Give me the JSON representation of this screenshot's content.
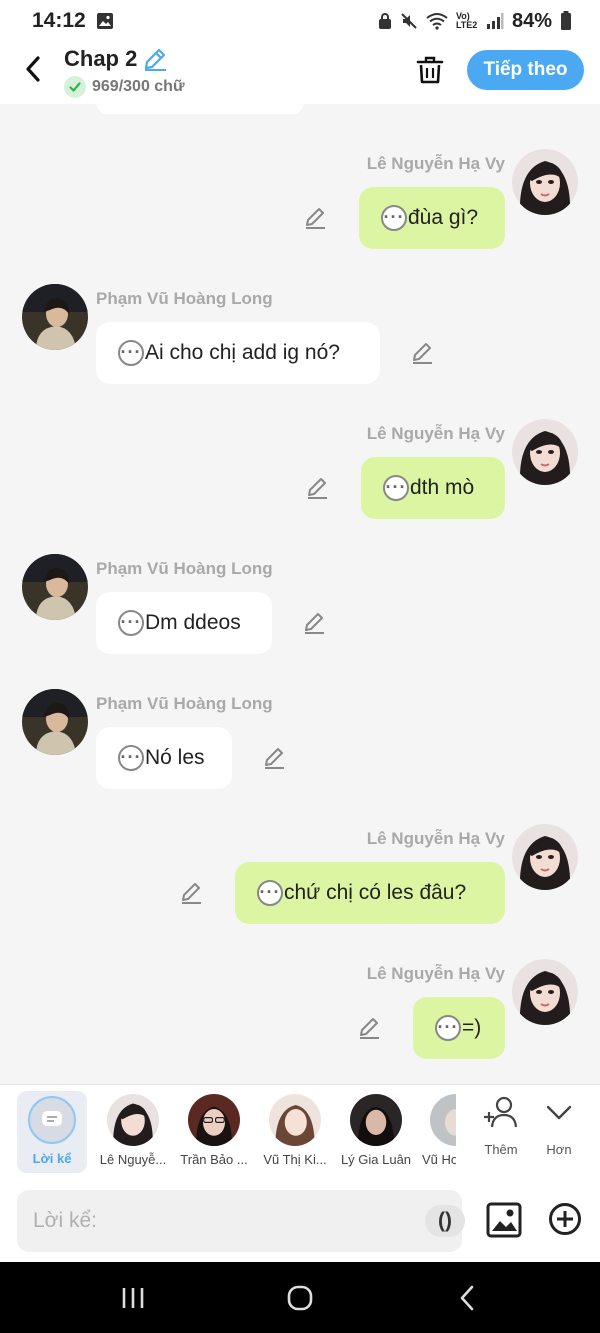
{
  "status_bar": {
    "time": "14:12",
    "battery": "84%",
    "network_label": "Vo) LTE2"
  },
  "header": {
    "title": "Chap 2",
    "word_count": "969/300 chữ",
    "next_button": "Tiếp theo"
  },
  "messages": [
    {
      "sender": "Lê Nguyễn Hạ Vy",
      "text": "đùa gì?",
      "side": "right"
    },
    {
      "sender": "Phạm Vũ Hoàng Long",
      "text": "Ai cho chị add ig nó?",
      "side": "left"
    },
    {
      "sender": "Lê Nguyễn Hạ Vy",
      "text": "dth mò",
      "side": "right"
    },
    {
      "sender": "Phạm Vũ Hoàng Long",
      "text": "Dm ddeos",
      "side": "left"
    },
    {
      "sender": "Phạm Vũ Hoàng Long",
      "text": "Nó les",
      "side": "left"
    },
    {
      "sender": "Lê Nguyễn Hạ Vy",
      "text": "chứ chị có les đâu?",
      "side": "right"
    },
    {
      "sender": "Lê Nguyễn Hạ Vy",
      "text": "=)",
      "side": "right"
    }
  ],
  "characters": {
    "narrator": "Lời kể",
    "items": [
      "Lê Nguyễ...",
      "Trần Bảo ...",
      "Vũ Thị Ki...",
      "Lý Gia Luân",
      "Vũ Ho"
    ],
    "add_label": "Thêm",
    "more_label": "Hơn"
  },
  "input": {
    "placeholder": "Lời kể:",
    "paren_button": "()"
  },
  "colors": {
    "accent": "#4aa9f2",
    "outgoing_bubble": "#dcf5a2",
    "incoming_bubble": "#ffffff",
    "background": "#f5f5f5"
  }
}
